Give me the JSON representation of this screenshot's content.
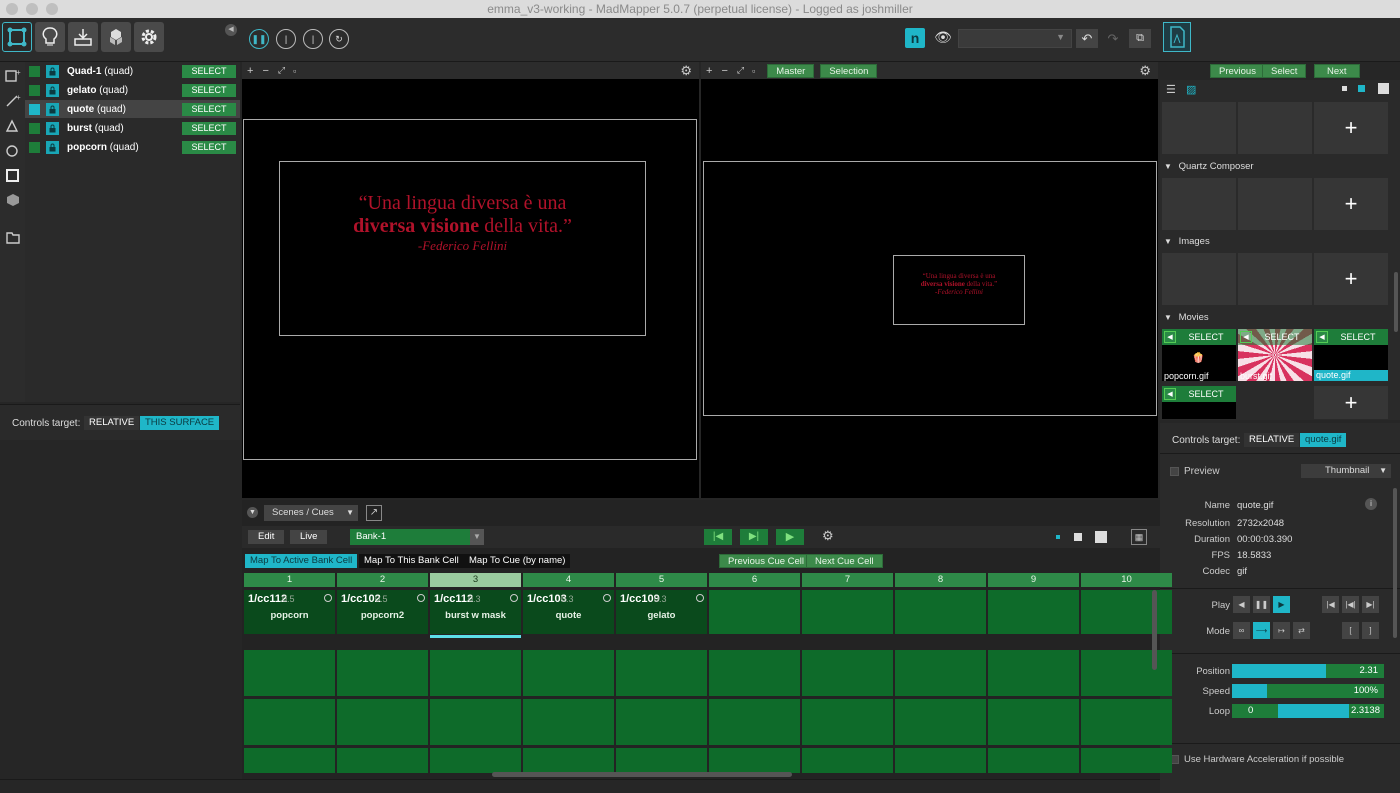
{
  "window": {
    "title": "emma_v3-working - MadMapper 5.0.7 (perpetual license) - Logged as joshmiller"
  },
  "surfaces": [
    {
      "name": "Quad-1",
      "type": "(quad)",
      "button": "SELECT"
    },
    {
      "name": "gelato",
      "type": "(quad)",
      "button": "SELECT"
    },
    {
      "name": "quote",
      "type": "(quad)",
      "button": "SELECT"
    },
    {
      "name": "burst",
      "type": "(quad)",
      "button": "SELECT"
    },
    {
      "name": "popcorn",
      "type": "(quad)",
      "button": "SELECT"
    }
  ],
  "left_controls": {
    "label": "Controls target:",
    "relative": "RELATIVE",
    "target": "THIS SURFACE"
  },
  "output_view": {
    "master": "Master",
    "selection": "Selection"
  },
  "quote": {
    "line1": "“Una lingua diversa è una",
    "line2_bold": "diversa visione",
    "line2_rest": " della vita.”",
    "author": "-Federico Fellini"
  },
  "library": {
    "previous": "Previous",
    "select": "Select",
    "next": "Next",
    "sections": [
      "Quartz Composer",
      "Images",
      "Movies"
    ],
    "movies": [
      {
        "name": "popcorn.gif",
        "button": "SELECT"
      },
      {
        "name": "burst.gif",
        "button": "SELECT"
      },
      {
        "name": "quote.gif",
        "button": "SELECT"
      },
      {
        "name": "",
        "button": "SELECT"
      }
    ]
  },
  "props": {
    "controls_label": "Controls target:",
    "relative": "RELATIVE",
    "target": "quote.gif",
    "preview": "Preview",
    "thumb": "Thumbnail",
    "name_label": "Name",
    "name": "quote.gif",
    "res_label": "Resolution",
    "resolution": "2732x2048",
    "dur_label": "Duration",
    "duration": "00:00:03.390",
    "fps_label": "FPS",
    "fps": "18.5833",
    "codec_label": "Codec",
    "codec": "gif",
    "play_label": "Play",
    "mode_label": "Mode",
    "position_label": "Position",
    "position": "2.31",
    "position_fraction": 0.62,
    "speed_label": "Speed",
    "speed": "100%",
    "speed_fraction": 0.23,
    "loop_label": "Loop",
    "loop_start": "0",
    "loop_end": "2.3138",
    "loop_range": [
      0.3,
      0.77
    ],
    "hw_accel": "Use Hardware Acceleration if possible"
  },
  "scenes": {
    "dropdown": "Scenes / Cues",
    "edit": "Edit",
    "live": "Live",
    "bank": "Bank-1",
    "map_active": "Map To Active Bank Cell",
    "map_this": "Map To This Bank Cell",
    "map_cue": "Map To Cue (by name)",
    "prev_cue": "Previous Cue Cell",
    "next_cue": "Next Cue Cell",
    "columns": [
      "1",
      "2",
      "3",
      "4",
      "5",
      "6",
      "7",
      "8",
      "9",
      "10"
    ],
    "active_column": "3",
    "cues": [
      {
        "id": "1/cc112",
        "opacity": "0.5",
        "name": "popcorn"
      },
      {
        "id": "1/cc102",
        "opacity": "0.5",
        "name": "popcorn2"
      },
      {
        "id": "1/cc112",
        "opacity": "0.3",
        "name": "burst w mask"
      },
      {
        "id": "1/cc103",
        "opacity": "0.3",
        "name": "quote"
      },
      {
        "id": "1/cc109",
        "opacity": "0.3",
        "name": "gelato"
      }
    ],
    "op_label": "o:"
  }
}
